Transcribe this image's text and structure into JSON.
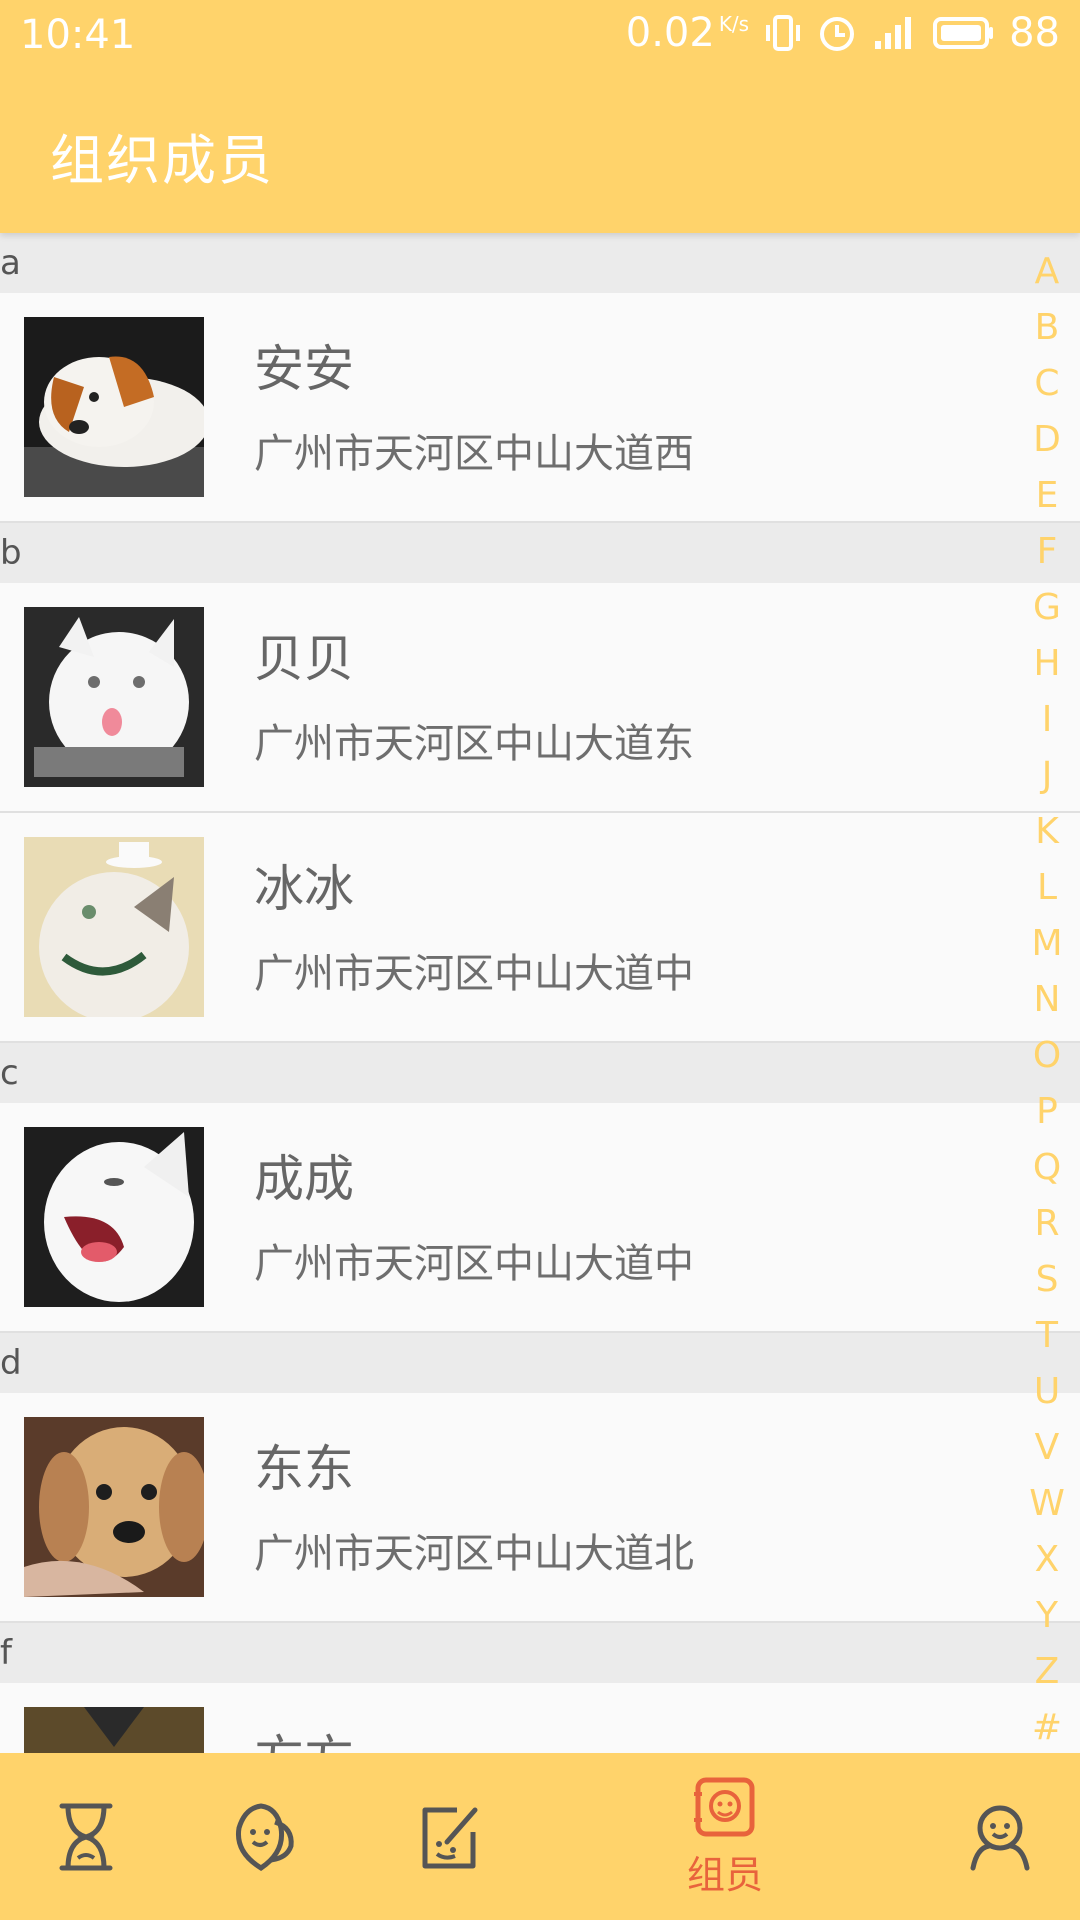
{
  "status_bar": {
    "time": "10:41",
    "net_speed": "0.02",
    "net_unit": "K/s",
    "battery": "88"
  },
  "appbar": {
    "title": "组织成员"
  },
  "sections": [
    {
      "letter": "a",
      "members": [
        {
          "name": "安安",
          "address": "广州市天河区中山大道西",
          "avatar": "puppy-photo"
        }
      ]
    },
    {
      "letter": "b",
      "members": [
        {
          "name": "贝贝",
          "address": "广州市天河区中山大道东",
          "avatar": "white-cat-photo"
        },
        {
          "name": "冰冰",
          "address": "广州市天河区中山大道中",
          "avatar": "cat-with-hat-photo"
        }
      ]
    },
    {
      "letter": "c",
      "members": [
        {
          "name": "成成",
          "address": "广州市天河区中山大道中",
          "avatar": "yawning-cat-photo"
        }
      ]
    },
    {
      "letter": "d",
      "members": [
        {
          "name": "东东",
          "address": "广州市天河区中山大道北",
          "avatar": "golden-puppy-photo"
        }
      ]
    },
    {
      "letter": "f",
      "members": [
        {
          "name": "方方",
          "address": "",
          "avatar": "dog-photo"
        }
      ]
    }
  ],
  "index_letters": [
    "A",
    "B",
    "C",
    "D",
    "E",
    "F",
    "G",
    "H",
    "I",
    "J",
    "K",
    "L",
    "M",
    "N",
    "O",
    "P",
    "Q",
    "R",
    "S",
    "T",
    "U",
    "V",
    "W",
    "X",
    "Y",
    "Z",
    "#"
  ],
  "bottom_nav": {
    "items": [
      {
        "icon": "hourglass-icon"
      },
      {
        "icon": "leaf-icon"
      },
      {
        "icon": "note-edit-icon"
      },
      {
        "icon": "members-icon",
        "label": "组员",
        "active": true
      },
      {
        "icon": "profile-icon"
      }
    ]
  },
  "colors": {
    "primary": "#ffd36b",
    "active": "#e8633c",
    "section_bg": "#ebebeb"
  }
}
